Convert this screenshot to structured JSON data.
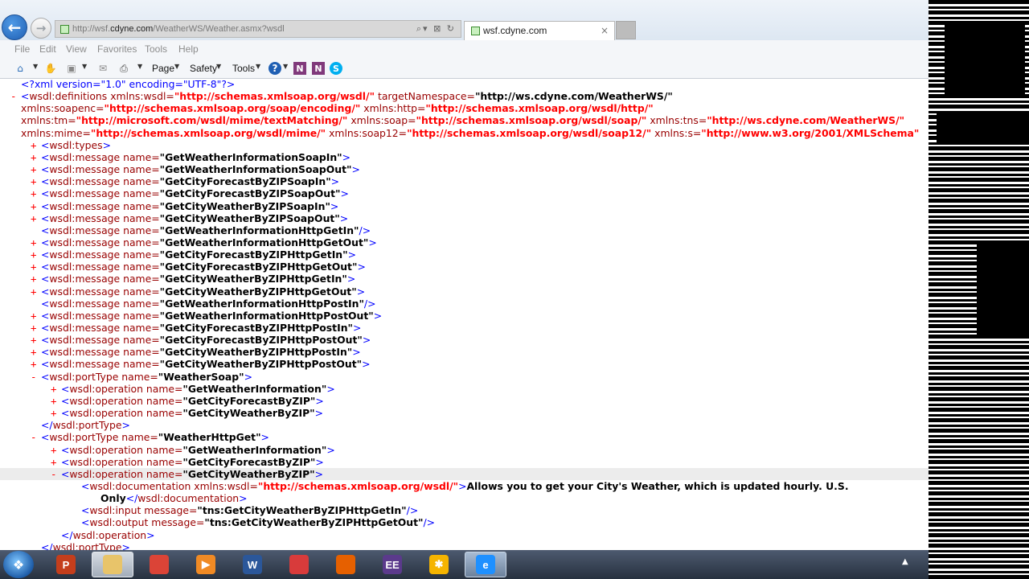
{
  "browser": {
    "address_bar": {
      "url_prefix": "http://wsf.",
      "url_domain": "cdyne.com",
      "url_path": "/WeatherWS/Weather.asmx?wsdl",
      "tools": "⌕▾ ⊠ ↻"
    },
    "tab": {
      "title": "wsf.cdyne.com",
      "close": "×"
    },
    "nav": {
      "back": "←",
      "forward": "→"
    },
    "menu": [
      "File",
      "Edit",
      "View",
      "Favorites",
      "Tools",
      "Help"
    ],
    "command_bar": {
      "page": "Page",
      "safety": "Safety",
      "tools": "Tools",
      "help": "?"
    }
  },
  "xml": {
    "prolog": {
      "open": "<?",
      "body": "xml version=\"1.0\" encoding=\"UTF-8\"",
      "close": "?>"
    },
    "definitions": {
      "toggle": "-",
      "line1": {
        "tag": "wsdl:definitions",
        "a1n": "xmlns:wsdl=",
        "a1v": "\"http://schemas.xmlsoap.org/wsdl/\"",
        "a2n": " targetNamespace=",
        "a2v": "\"http://ws.cdyne.com/WeatherWS/\""
      },
      "line2": {
        "a1n": "xmlns:soapenc=",
        "a1v": "\"http://schemas.xmlsoap.org/soap/encoding/\"",
        "a2n": " xmlns:http=",
        "a2v": "\"http://schemas.xmlsoap.org/wsdl/http/\""
      },
      "line3": {
        "a1n": "xmlns:tm=",
        "a1v": "\"http://microsoft.com/wsdl/mime/textMatching/\"",
        "a2n": " xmlns:soap=",
        "a2v": "\"http://schemas.xmlsoap.org/wsdl/soap/\"",
        "a3n": " xmlns:tns=",
        "a3v": "\"http://ws.cdyne.com/WeatherWS/\""
      },
      "line4": {
        "a1n": "xmlns:mime=",
        "a1v": "\"http://schemas.xmlsoap.org/wsdl/mime/\"",
        "a2n": " xmlns:soap12=",
        "a2v": "\"http://schemas.xmlsoap.org/wsdl/soap12/\"",
        "a3n": " xmlns:s=",
        "a3v": "\"http://www.w3.org/2001/XMLSchema\""
      }
    },
    "types": {
      "toggle": "+",
      "tag": "wsdl:types"
    },
    "messages": [
      {
        "toggle": "+",
        "name": "\"GetWeatherInformationSoapIn\"",
        "close": ">"
      },
      {
        "toggle": "+",
        "name": "\"GetWeatherInformationSoapOut\"",
        "close": ">"
      },
      {
        "toggle": "+",
        "name": "\"GetCityForecastByZIPSoapIn\"",
        "close": ">"
      },
      {
        "toggle": "+",
        "name": "\"GetCityForecastByZIPSoapOut\"",
        "close": ">"
      },
      {
        "toggle": "+",
        "name": "\"GetCityWeatherByZIPSoapIn\"",
        "close": ">"
      },
      {
        "toggle": "+",
        "name": "\"GetCityWeatherByZIPSoapOut\"",
        "close": ">"
      },
      {
        "toggle": "",
        "name": "\"GetWeatherInformationHttpGetIn\"",
        "close": "/>"
      },
      {
        "toggle": "+",
        "name": "\"GetWeatherInformationHttpGetOut\"",
        "close": ">"
      },
      {
        "toggle": "+",
        "name": "\"GetCityForecastByZIPHttpGetIn\"",
        "close": ">"
      },
      {
        "toggle": "+",
        "name": "\"GetCityForecastByZIPHttpGetOut\"",
        "close": ">"
      },
      {
        "toggle": "+",
        "name": "\"GetCityWeatherByZIPHttpGetIn\"",
        "close": ">"
      },
      {
        "toggle": "+",
        "name": "\"GetCityWeatherByZIPHttpGetOut\"",
        "close": ">"
      },
      {
        "toggle": "",
        "name": "\"GetWeatherInformationHttpPostIn\"",
        "close": "/>"
      },
      {
        "toggle": "+",
        "name": "\"GetWeatherInformationHttpPostOut\"",
        "close": ">"
      },
      {
        "toggle": "+",
        "name": "\"GetCityForecastByZIPHttpPostIn\"",
        "close": ">"
      },
      {
        "toggle": "+",
        "name": "\"GetCityForecastByZIPHttpPostOut\"",
        "close": ">"
      },
      {
        "toggle": "+",
        "name": "\"GetCityWeatherByZIPHttpPostIn\"",
        "close": ">"
      },
      {
        "toggle": "+",
        "name": "\"GetCityWeatherByZIPHttpPostOut\"",
        "close": ">"
      }
    ],
    "porttype_soap": {
      "toggle": "-",
      "name": "\"WeatherSoap\"",
      "ops": [
        "\"GetWeatherInformation\"",
        "\"GetCityForecastByZIP\"",
        "\"GetCityWeatherByZIP\""
      ],
      "close_tag": "wsdl:portType"
    },
    "porttype_httpget": {
      "toggle": "-",
      "name": "\"WeatherHttpGet\"",
      "ops": [
        "\"GetWeatherInformation\"",
        "\"GetCityForecastByZIP\"",
        "\"GetCityWeatherByZIP\""
      ],
      "doc": {
        "tag": "wsdl:documentation",
        "attr_name": " xmlns:wsdl=",
        "attr_value": "\"http://schemas.xmlsoap.org/wsdl/\"",
        "text1": "Allows you to get your City's Weather, which is updated hourly. U.S.",
        "text2": "Only",
        "close_tag": "wsdl:documentation"
      },
      "input": {
        "tag": "wsdl:input",
        "attr": " message=",
        "value": "\"tns:GetCityWeatherByZIPHttpGetIn\""
      },
      "output": {
        "tag": "wsdl:output",
        "attr": " message=",
        "value": "\"tns:GetCityWeatherByZIPHttpGetOut\""
      },
      "op_close": "wsdl:operation",
      "pt_close": "wsdl:portType"
    },
    "common": {
      "message_tag": "wsdl:message",
      "name_attr": " name=",
      "operation_tag": "wsdl:operation",
      "porttype_tag": "wsdl:portType"
    }
  },
  "taskbar": {
    "apps": [
      {
        "label": "P",
        "color": "#c43e1c"
      },
      {
        "label": "",
        "color": "#e8c46a"
      },
      {
        "label": "",
        "color": "#db4437"
      },
      {
        "label": "▶",
        "color": "#f08a24"
      },
      {
        "label": "W",
        "color": "#2b579a"
      },
      {
        "label": "",
        "color": "#d83b3b"
      },
      {
        "label": "",
        "color": "#e66000"
      },
      {
        "label": "EE",
        "color": "#5b3a8c"
      },
      {
        "label": "✱",
        "color": "#f5b400"
      },
      {
        "label": "e",
        "color": "#1e90ff"
      }
    ],
    "tray_up": "▲"
  }
}
